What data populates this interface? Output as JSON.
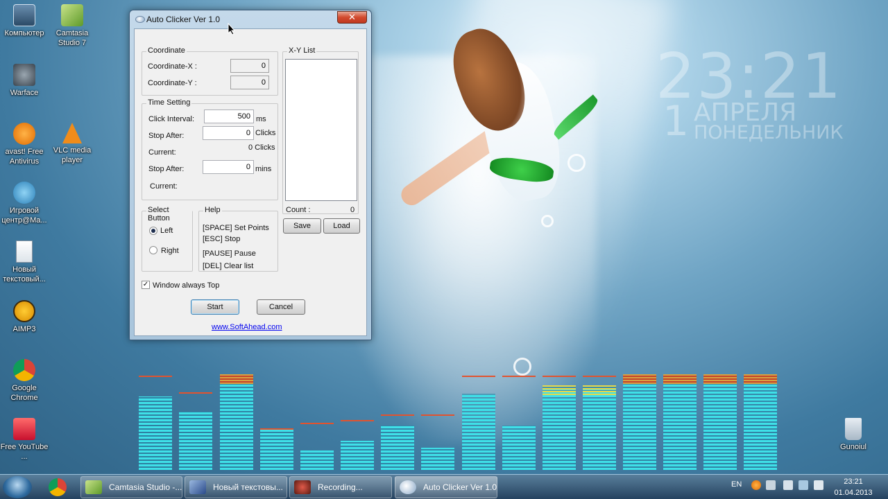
{
  "desktop": {
    "icons": [
      {
        "label": "Компьютер"
      },
      {
        "label": "Camtasia Studio 7"
      },
      {
        "label": "Warface"
      },
      {
        "label": "avast! Free Antivirus"
      },
      {
        "label": "VLC media player"
      },
      {
        "label": "Игровой центр@Ma..."
      },
      {
        "label": "Новый текстовый..."
      },
      {
        "label": "AIMP3"
      },
      {
        "label": "Google Chrome"
      },
      {
        "label": "Free YouTube ..."
      },
      {
        "label": "Gunoiul"
      }
    ],
    "clock_widget": {
      "time": "23:21",
      "day": "1",
      "month": "АПРЕЛЯ",
      "weekday": "ПОНЕДЕЛЬНИК"
    }
  },
  "window": {
    "title": "Auto Clicker Ver 1.0",
    "close_glyph": "✕",
    "coordinate": {
      "group_label": "Coordinate",
      "x_label": "Coordinate-X :",
      "x_value": "0",
      "y_label": "Coordinate-Y :",
      "y_value": "0"
    },
    "time_setting": {
      "group_label": "Time Setting",
      "click_interval_label": "Click Interval:",
      "click_interval_value": "500",
      "click_interval_unit": "ms",
      "stop_after_clicks_label": "Stop After:",
      "stop_after_clicks_value": "0",
      "stop_after_clicks_unit": "Clicks",
      "current_clicks_label": "Current:",
      "current_clicks_value": "0 Clicks",
      "stop_after_mins_label": "Stop After:",
      "stop_after_mins_value": "0",
      "stop_after_mins_unit": "mins",
      "current_mins_label": "Current:"
    },
    "xy_list": {
      "group_label": "X-Y List",
      "count_label": "Count :",
      "count_value": "0",
      "save_label": "Save",
      "load_label": "Load"
    },
    "select_button": {
      "group_label": "Select Button",
      "left_label": "Left",
      "right_label": "Right",
      "selected": "Left"
    },
    "help": {
      "group_label": "Help",
      "lines": [
        "[SPACE] Set Points",
        "[ESC] Stop",
        "[PAUSE] Pause",
        "[DEL] Clear list"
      ]
    },
    "always_top_label": "Window always Top",
    "always_top_checked": true,
    "start_label": "Start",
    "cancel_label": "Cancel",
    "link_text": "www.SoftAhead.com"
  },
  "taskbar": {
    "items": [
      {
        "label": "Camtasia Studio -..."
      },
      {
        "label": "Новый текстовы..."
      },
      {
        "label": "Recording..."
      },
      {
        "label": "Auto Clicker Ver 1.0"
      }
    ],
    "language": "EN",
    "time": "23:21",
    "date": "01.04.2013"
  },
  "colors": {
    "eq_bar": "#3fe0e8",
    "eq_peak": "#e2532e",
    "link": "#0000ee"
  }
}
